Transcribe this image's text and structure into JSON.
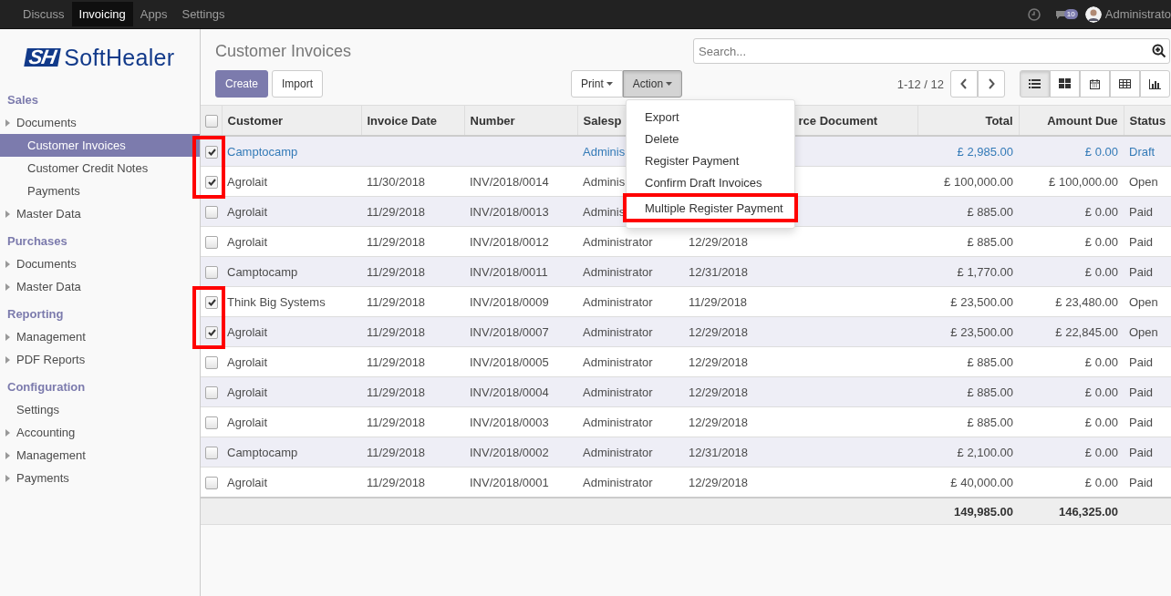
{
  "top_menu": [
    {
      "label": "Discuss",
      "selected": false
    },
    {
      "label": "Invoicing",
      "selected": true
    },
    {
      "label": "Apps",
      "selected": false
    },
    {
      "label": "Settings",
      "selected": false
    }
  ],
  "systray": {
    "message_count": "10",
    "user": "Administrato"
  },
  "logo": {
    "mark": "SH",
    "text": "SoftHealer"
  },
  "sidebar": [
    {
      "title": "Sales",
      "items": [
        {
          "label": "Documents",
          "kind": "folder",
          "selected": false,
          "children": [
            {
              "label": "Customer Invoices",
              "kind": "leaf",
              "selected": true
            },
            {
              "label": "Customer Credit Notes",
              "kind": "leaf",
              "selected": false
            },
            {
              "label": "Payments",
              "kind": "leaf",
              "selected": false
            }
          ]
        },
        {
          "label": "Master Data",
          "kind": "folder",
          "selected": false
        }
      ]
    },
    {
      "title": "Purchases",
      "items": [
        {
          "label": "Documents",
          "kind": "folder",
          "selected": false
        },
        {
          "label": "Master Data",
          "kind": "folder",
          "selected": false
        }
      ]
    },
    {
      "title": "Reporting",
      "items": [
        {
          "label": "Management",
          "kind": "folder",
          "selected": false
        },
        {
          "label": "PDF Reports",
          "kind": "folder",
          "selected": false
        }
      ]
    },
    {
      "title": "Configuration",
      "items": [
        {
          "label": "Settings",
          "kind": "leaf",
          "selected": false
        },
        {
          "label": "Accounting",
          "kind": "folder",
          "selected": false
        },
        {
          "label": "Management",
          "kind": "folder",
          "selected": false
        },
        {
          "label": "Payments",
          "kind": "folder",
          "selected": false
        }
      ]
    }
  ],
  "page_title": "Customer Invoices",
  "search": {
    "placeholder": "Search..."
  },
  "buttons": {
    "create": "Create",
    "import": "Import",
    "print": "Print",
    "action": "Action"
  },
  "pager": "1-12 / 12",
  "views": [
    {
      "kind": "list",
      "selected": true
    },
    {
      "kind": "kanban",
      "selected": false
    },
    {
      "kind": "calendar",
      "selected": false
    },
    {
      "kind": "pivot",
      "selected": false
    },
    {
      "kind": "graph",
      "selected": false
    }
  ],
  "action_menu": [
    {
      "label": "Export",
      "marked": false
    },
    {
      "label": "Delete",
      "marked": false
    },
    {
      "label": "Register Payment",
      "marked": false
    },
    {
      "label": "Confirm Draft Invoices",
      "marked": false
    },
    {
      "label": "Multiple Register Payment",
      "marked": true
    }
  ],
  "table": {
    "select_all": false,
    "columns": [
      {
        "label": "Customer",
        "kind": "text"
      },
      {
        "label": "Invoice Date",
        "kind": "text"
      },
      {
        "label": "Number",
        "kind": "text"
      },
      {
        "label": "Salesp",
        "kind": "text"
      },
      {
        "kind": "text"
      },
      {
        "label": "rce Document",
        "kind": "text"
      },
      {
        "label": "Total",
        "kind": "money"
      },
      {
        "label": "Amount Due",
        "kind": "money"
      },
      {
        "label": "Status",
        "kind": "text"
      }
    ],
    "rows": [
      {
        "checked": true,
        "marked": true,
        "draft": true,
        "cells": [
          "Camptocamp",
          null,
          null,
          "Adminis",
          null,
          null,
          "£ 2,985.00",
          "£ 0.00",
          "Draft"
        ]
      },
      {
        "checked": true,
        "marked": true,
        "draft": false,
        "cells": [
          "Agrolait",
          "11/30/2018",
          "INV/2018/0014",
          "Adminis",
          null,
          null,
          "£ 100,000.00",
          "£ 100,000.00",
          "Open"
        ]
      },
      {
        "checked": false,
        "marked": false,
        "draft": false,
        "cells": [
          "Agrolait",
          "11/29/2018",
          "INV/2018/0013",
          "Adminis",
          null,
          null,
          "£ 885.00",
          "£ 0.00",
          "Paid"
        ]
      },
      {
        "checked": false,
        "marked": false,
        "draft": false,
        "cells": [
          "Agrolait",
          "11/29/2018",
          "INV/2018/0012",
          "Administrator",
          "12/29/2018",
          null,
          "£ 885.00",
          "£ 0.00",
          "Paid"
        ]
      },
      {
        "checked": false,
        "marked": false,
        "draft": false,
        "cells": [
          "Camptocamp",
          "11/29/2018",
          "INV/2018/0011",
          "Administrator",
          "12/31/2018",
          null,
          "£ 1,770.00",
          "£ 0.00",
          "Paid"
        ]
      },
      {
        "checked": true,
        "marked": true,
        "draft": false,
        "cells": [
          "Think Big Systems",
          "11/29/2018",
          "INV/2018/0009",
          "Administrator",
          "11/29/2018",
          null,
          "£ 23,500.00",
          "£ 23,480.00",
          "Open"
        ]
      },
      {
        "checked": true,
        "marked": true,
        "draft": false,
        "cells": [
          "Agrolait",
          "11/29/2018",
          "INV/2018/0007",
          "Administrator",
          "12/29/2018",
          null,
          "£ 23,500.00",
          "£ 22,845.00",
          "Open"
        ]
      },
      {
        "checked": false,
        "marked": false,
        "draft": false,
        "cells": [
          "Agrolait",
          "11/29/2018",
          "INV/2018/0005",
          "Administrator",
          "12/29/2018",
          null,
          "£ 885.00",
          "£ 0.00",
          "Paid"
        ]
      },
      {
        "checked": false,
        "marked": false,
        "draft": false,
        "cells": [
          "Agrolait",
          "11/29/2018",
          "INV/2018/0004",
          "Administrator",
          "12/29/2018",
          null,
          "£ 885.00",
          "£ 0.00",
          "Paid"
        ]
      },
      {
        "checked": false,
        "marked": false,
        "draft": false,
        "cells": [
          "Agrolait",
          "11/29/2018",
          "INV/2018/0003",
          "Administrator",
          "12/29/2018",
          null,
          "£ 885.00",
          "£ 0.00",
          "Paid"
        ]
      },
      {
        "checked": false,
        "marked": false,
        "draft": false,
        "cells": [
          "Camptocamp",
          "11/29/2018",
          "INV/2018/0002",
          "Administrator",
          "12/31/2018",
          null,
          "£ 2,100.00",
          "£ 0.00",
          "Paid"
        ]
      },
      {
        "checked": false,
        "marked": false,
        "draft": false,
        "cells": [
          "Agrolait",
          "11/29/2018",
          "INV/2018/0001",
          "Administrator",
          "12/29/2018",
          null,
          "£ 40,000.00",
          "£ 0.00",
          "Paid"
        ]
      }
    ],
    "totals": [
      "149,985.00",
      "146,325.00"
    ]
  }
}
